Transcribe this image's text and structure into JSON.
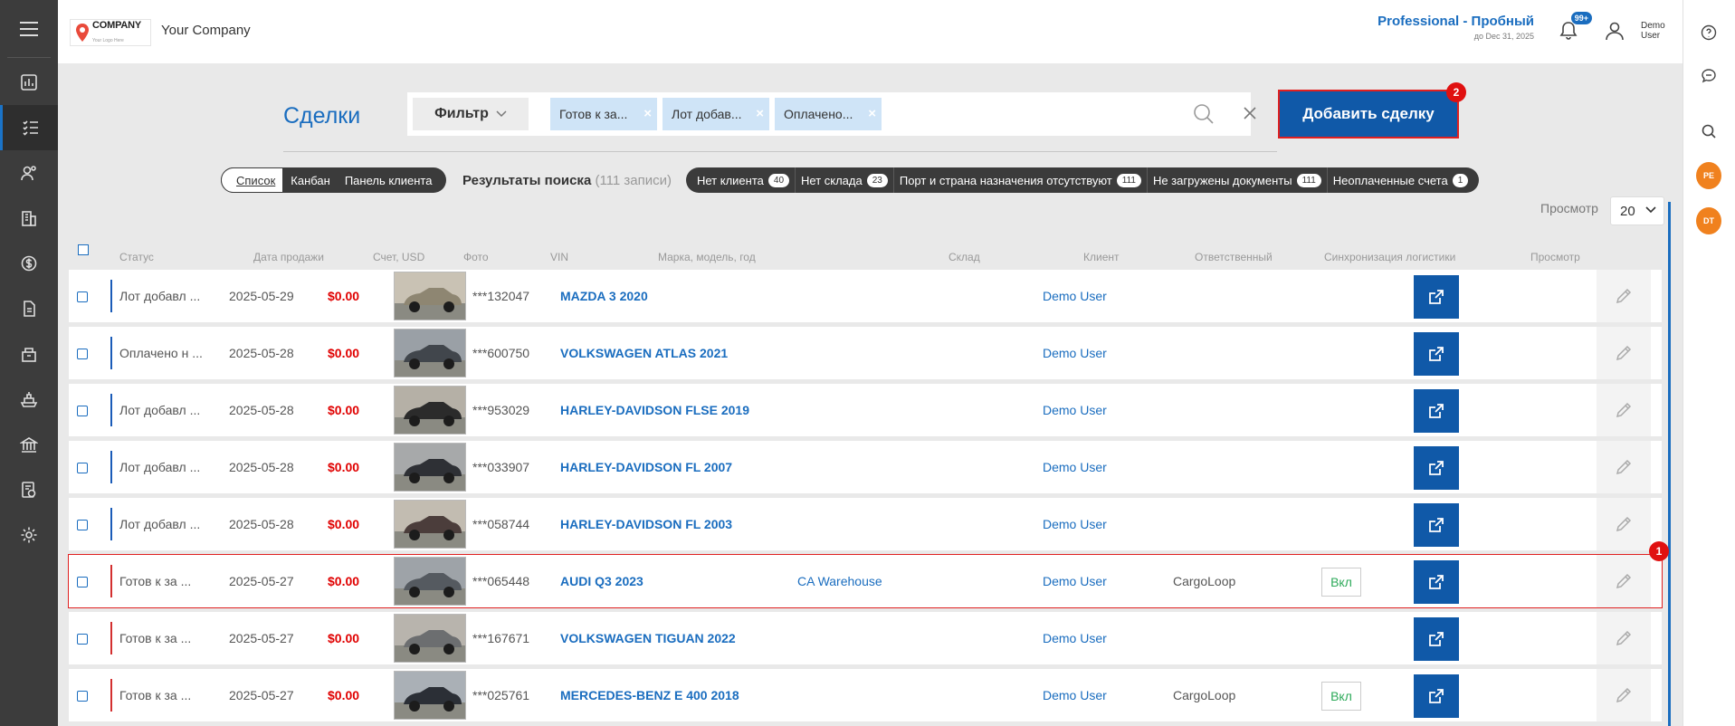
{
  "header": {
    "logo_title": "COMPANY",
    "logo_sub": "Your Logo Here",
    "company_name": "Your Company",
    "plan_name": "Professional - Пробный",
    "plan_expiry": "до Dec 31, 2025",
    "notif_count": "99+",
    "user_name": "Demo User"
  },
  "right_rail": {
    "badge1": "PE",
    "badge2": "DT"
  },
  "page": {
    "title": "Сделки",
    "filter_label": "Фильтр",
    "chips": [
      "Готов к за...",
      "Лот добав...",
      "Оплачено..."
    ],
    "add_button": "Добавить сделку",
    "marker_add": "2",
    "marker_row": "1"
  },
  "views": {
    "list": "Список",
    "kanban": "Канбан",
    "client_panel": "Панель клиента"
  },
  "results": {
    "label": "Результаты поиска",
    "count": "(111 записи)"
  },
  "quick_filters": [
    {
      "label": "Нет клиента",
      "count": "40"
    },
    {
      "label": "Нет склада",
      "count": "23"
    },
    {
      "label": "Порт и страна назначения отсутствуют",
      "count": "111"
    },
    {
      "label": "Не загружены документы",
      "count": "111"
    },
    {
      "label": "Неоплаченные счета",
      "count": "1"
    }
  ],
  "pager": {
    "label": "Просмотр",
    "value": "20"
  },
  "columns": {
    "status": "Статус",
    "date": "Дата продажи",
    "amount": "Счет, USD",
    "photo": "Фото",
    "vin": "VIN",
    "model": "Марка, модель, год",
    "warehouse": "Склад",
    "client": "Клиент",
    "responsible": "Ответственный",
    "sync": "Синхронизация логистики",
    "view": "Просмотр"
  },
  "rows": [
    {
      "status": "Лот добавл ...",
      "date": "2025-05-29",
      "amount": "$0.00",
      "vin": "***132047",
      "model": "MAZDA 3 2020",
      "warehouse": "",
      "responsible": "Demo User",
      "sync": "",
      "on": ""
    },
    {
      "status": "Оплачено н ...",
      "date": "2025-05-28",
      "amount": "$0.00",
      "vin": "***600750",
      "model": "VOLKSWAGEN ATLAS 2021",
      "warehouse": "",
      "responsible": "Demo User",
      "sync": "",
      "on": ""
    },
    {
      "status": "Лот добавл ...",
      "date": "2025-05-28",
      "amount": "$0.00",
      "vin": "***953029",
      "model": "HARLEY-DAVIDSON FLSE 2019",
      "warehouse": "",
      "responsible": "Demo User",
      "sync": "",
      "on": ""
    },
    {
      "status": "Лот добавл ...",
      "date": "2025-05-28",
      "amount": "$0.00",
      "vin": "***033907",
      "model": "HARLEY-DAVIDSON FL 2007",
      "warehouse": "",
      "responsible": "Demo User",
      "sync": "",
      "on": ""
    },
    {
      "status": "Лот добавл ...",
      "date": "2025-05-28",
      "amount": "$0.00",
      "vin": "***058744",
      "model": "HARLEY-DAVIDSON FL 2003",
      "warehouse": "",
      "responsible": "Demo User",
      "sync": "",
      "on": ""
    },
    {
      "status": "Готов к за ...",
      "date": "2025-05-27",
      "amount": "$0.00",
      "vin": "***065448",
      "model": "AUDI Q3 2023",
      "warehouse": "CA Warehouse",
      "responsible": "Demo User",
      "sync": "CargoLoop",
      "on": "Вкл"
    },
    {
      "status": "Готов к за ...",
      "date": "2025-05-27",
      "amount": "$0.00",
      "vin": "***167671",
      "model": "VOLKSWAGEN TIGUAN 2022",
      "warehouse": "",
      "responsible": "Demo User",
      "sync": "",
      "on": ""
    },
    {
      "status": "Готов к за ...",
      "date": "2025-05-27",
      "amount": "$0.00",
      "vin": "***025761",
      "model": "MERCEDES-BENZ E 400 2018",
      "warehouse": "",
      "responsible": "Demo User",
      "sync": "CargoLoop",
      "on": "Вкл"
    }
  ],
  "colors": {
    "accent": "#1a6dbf",
    "button": "#1059a8",
    "danger": "#e00000",
    "sidebar": "#3c3c3c",
    "on_green": "#2eaa5a"
  }
}
